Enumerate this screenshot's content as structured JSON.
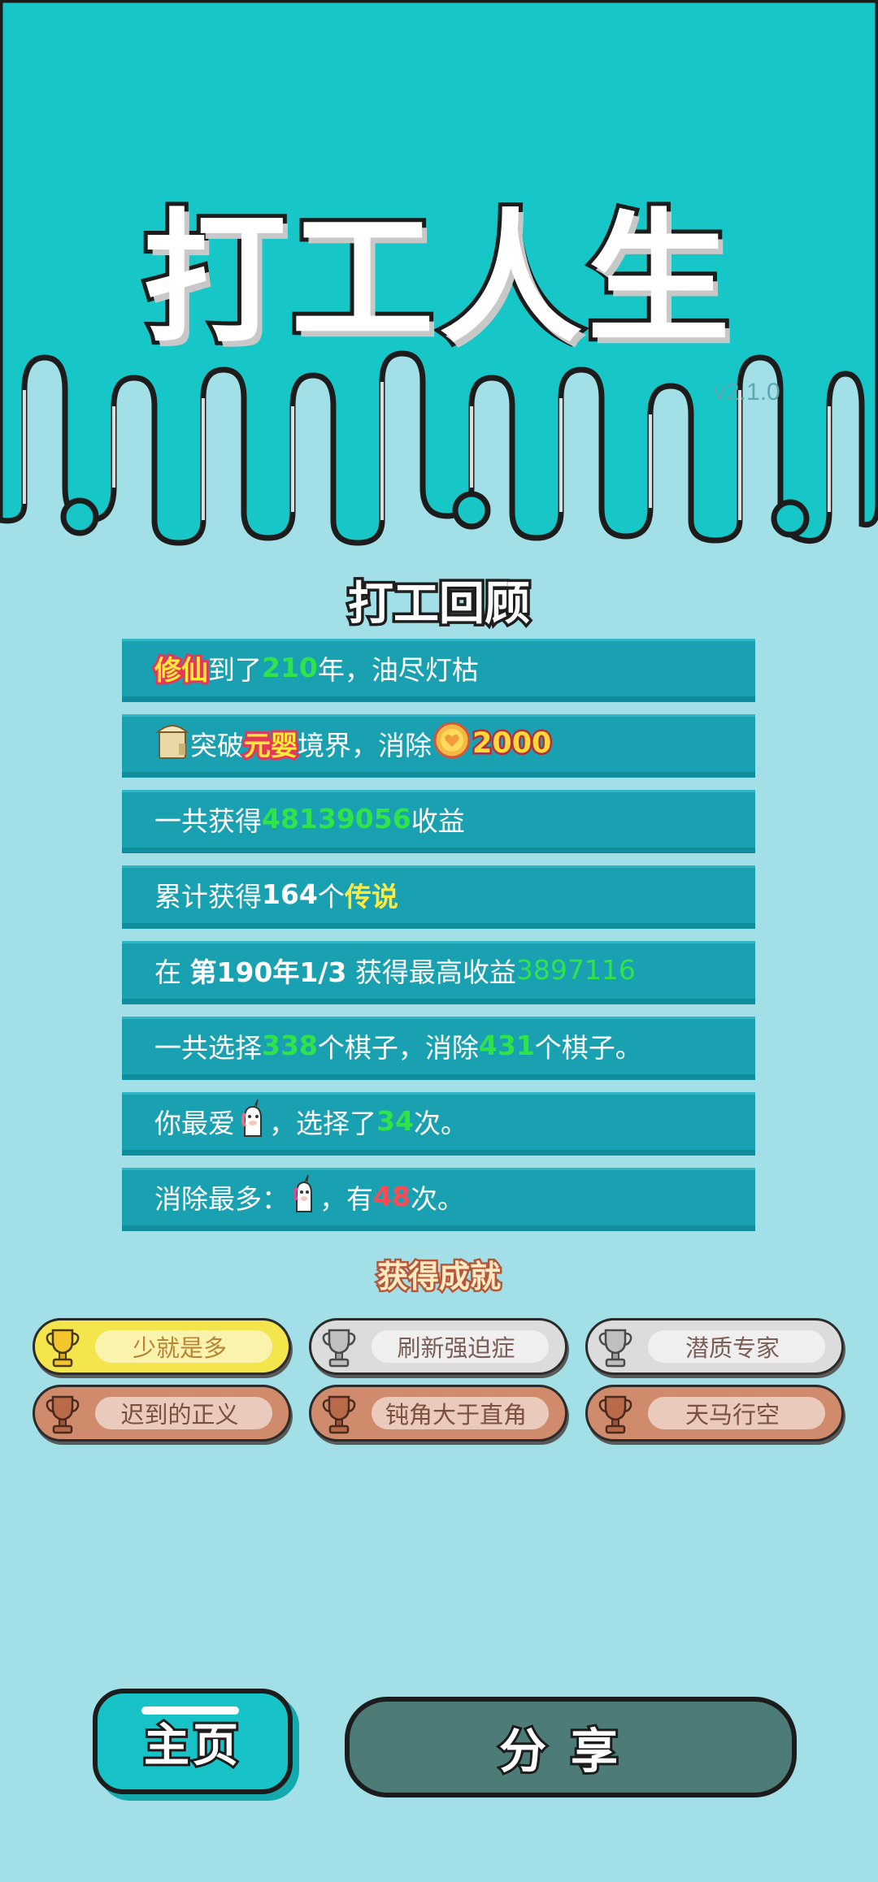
{
  "game": {
    "title": "打工人生",
    "version": "v2.1.0"
  },
  "review": {
    "title": "打工回顾",
    "rows": [
      {
        "p1": "修仙",
        "p2": "到了",
        "p3": "210",
        "p4": "年，油尽灯枯"
      },
      {
        "p1": "突破",
        "p2": "元婴",
        "p3": "境界，消除",
        "p4": "2000"
      },
      {
        "p1": "一共获得",
        "p2": "48139056",
        "p3": "收益"
      },
      {
        "p1": "累计获得",
        "p2": "164",
        "p3": "个",
        "p4": "传说"
      },
      {
        "p1": "在 ",
        "p2": "第190年1/3",
        "p3": " 获得最高收益",
        "p4": "3897116"
      },
      {
        "p1": "一共选择",
        "p2": "338",
        "p3": "个棋子，消除",
        "p4": "431",
        "p5": "个棋子。"
      },
      {
        "p1": "你最爱",
        "p2": "，选择了",
        "p3": "34",
        "p4": "次。"
      },
      {
        "p1": "消除最多：",
        "p2": "，有",
        "p3": "48",
        "p4": "次。"
      }
    ]
  },
  "achievements": {
    "title": "获得成就",
    "items": [
      {
        "label": "少就是多",
        "tier": "gold"
      },
      {
        "label": "刷新强迫症",
        "tier": "silver"
      },
      {
        "label": "潜质专家",
        "tier": "silver"
      },
      {
        "label": "迟到的正义",
        "tier": "bronze"
      },
      {
        "label": "钝角大于直角",
        "tier": "bronze"
      },
      {
        "label": "天马行空",
        "tier": "bronze"
      }
    ]
  },
  "buttons": {
    "home": "主页",
    "share": "分享"
  },
  "icons": {
    "realm": "scroll-icon",
    "coin": "heart-coin-icon",
    "favorite": "unicorn-icon",
    "most_eliminated": "unicorn-icon",
    "trophy": "trophy-icon"
  },
  "colors": {
    "header_bg": "#17c7c8",
    "page_bg": "#a3dfe6",
    "row_bg": "#1aa1b1",
    "highlight_green": "#2ee44a",
    "highlight_yellow": "#ffe93a",
    "highlight_red": "#ff4a54"
  }
}
